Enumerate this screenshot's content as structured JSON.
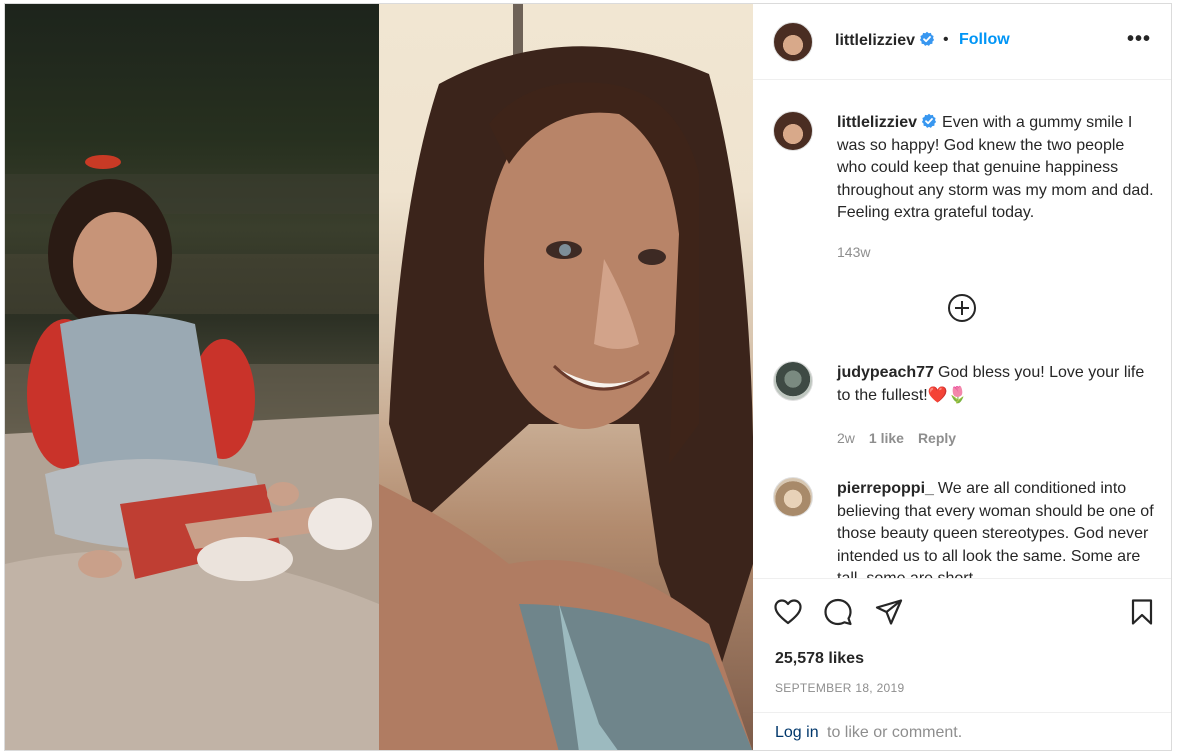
{
  "post": {
    "username": "littlelizziev",
    "follow_label": "Follow",
    "separator": "•",
    "more_label": "•••",
    "caption": "Even with a gummy smile I was so happy! God knew the two people who could keep that genuine happiness throughout any storm was my mom and dad. Feeling extra grateful today.",
    "age": "143w",
    "likes": "25,578 likes",
    "date": "SEPTEMBER 18, 2019"
  },
  "comments": [
    {
      "username": "judypeach77",
      "text": "God bless you! Love your life to the fullest!❤️🌷",
      "age": "2w",
      "likes": "1 like",
      "reply_label": "Reply"
    },
    {
      "username": "pierrepoppi_",
      "text": "We are all conditioned into believing that every woman should be one of those beauty queen stereotypes. God never intended us to all look the same. Some are tall, some are short,"
    }
  ],
  "footer": {
    "login_link": "Log in",
    "login_rest": "to like or comment."
  },
  "colors": {
    "accent": "#0095f6",
    "verified": "#3897f0",
    "muted": "#8e8e8e",
    "link": "#00376b"
  },
  "icons": [
    "verified-badge-icon",
    "more-options-icon",
    "load-more-comments-icon",
    "heart-icon",
    "comment-icon",
    "share-icon",
    "bookmark-icon"
  ]
}
